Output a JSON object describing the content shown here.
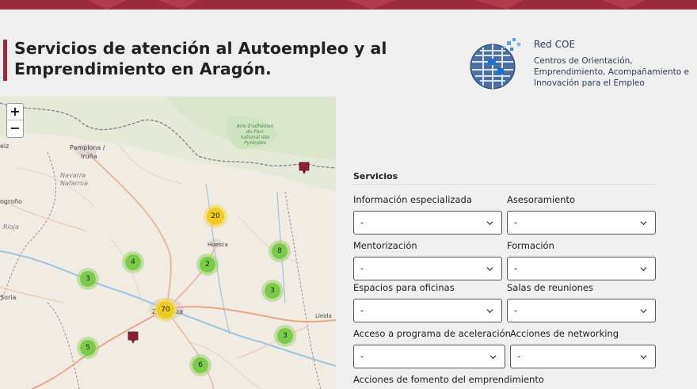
{
  "page": {
    "title": "Servicios de atención al Autoempleo y al Emprendimiento en Aragón."
  },
  "logo": {
    "name": "Red COE",
    "subtitle": "Centros de Orientación, Emprendimiento, Acompañamiento e Innovación para el Empleo"
  },
  "map": {
    "zoom_in": "+",
    "zoom_out": "−",
    "labels": {
      "pamplona": "Pamplona /",
      "irunea": "Iruña",
      "navarra": "Navarra",
      "nafarroa": "Nafarroa",
      "huesca": "Huesca",
      "zaragoza_a": "Z",
      "zaragoza_b": "za",
      "lleida": "Lleida",
      "soria": "Soria",
      "rioja": "Rioja",
      "logrono": "ogroño",
      "eiz": "eiz",
      "park": "Aire d'adhésion du Parc national des Pyrénées"
    },
    "clusters": [
      "20",
      "8",
      "4",
      "2",
      "3",
      "3",
      "70",
      "3",
      "5",
      "6"
    ]
  },
  "filters": {
    "section_title": "Servicios",
    "fields": [
      {
        "label": "Información especializada",
        "value": "-"
      },
      {
        "label": "Asesoramiento",
        "value": "-"
      },
      {
        "label": "Mentorización",
        "value": "-"
      },
      {
        "label": "Formación",
        "value": "-"
      },
      {
        "label": "Espacios para oficinas",
        "value": "-"
      },
      {
        "label": "Salas de reuniones",
        "value": "-"
      },
      {
        "label": "Acceso a programa de aceleración",
        "value": "-"
      },
      {
        "label": "Acciones de networking",
        "value": "-"
      },
      {
        "label": "Acciones de fomento del emprendimiento"
      }
    ]
  },
  "colors": {
    "accent": "#9c2a3d",
    "cluster_green": "#6ec83c",
    "cluster_yellow": "#f0c814"
  }
}
